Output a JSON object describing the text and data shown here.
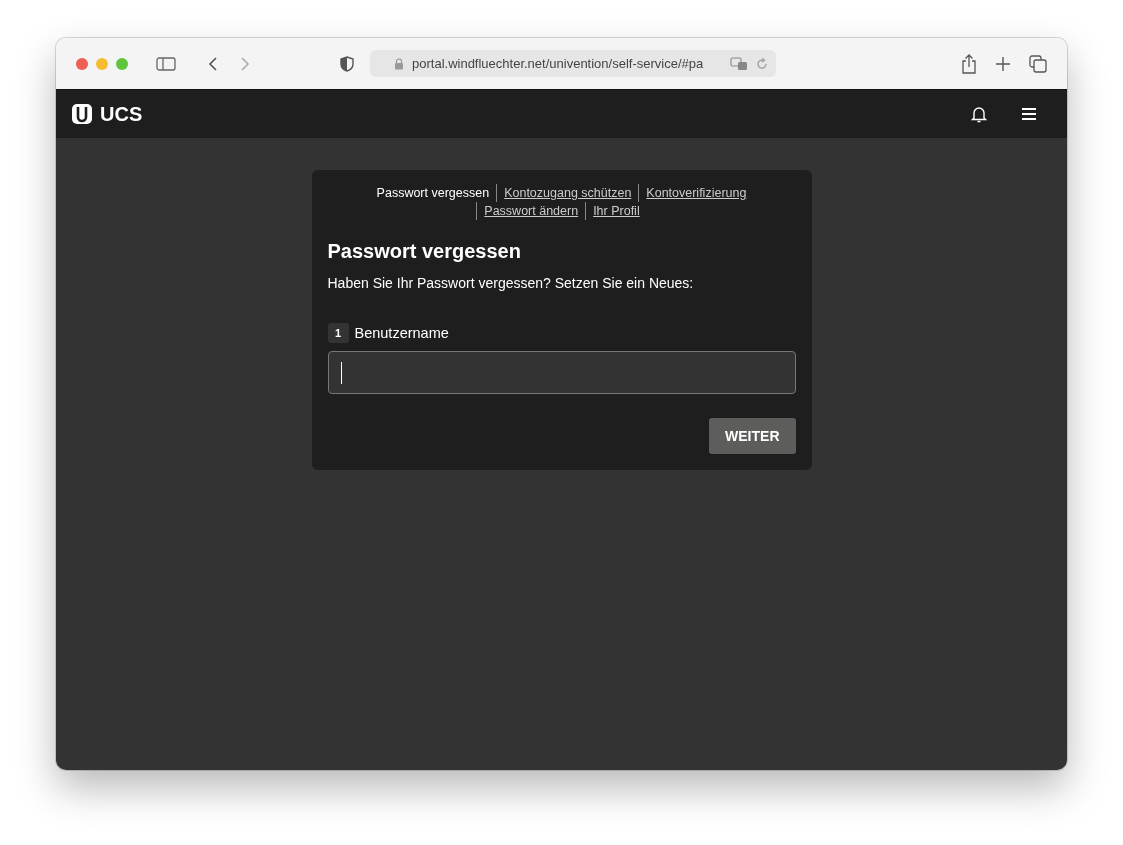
{
  "browser": {
    "url": "portal.windfluechter.net/univention/self-service/#pa"
  },
  "app_header": {
    "logo_text": "UCS"
  },
  "nav": [
    {
      "label": "Passwort vergessen",
      "selected": true
    },
    {
      "label": "Kontozugang schützen",
      "selected": false
    },
    {
      "label": "Kontoverifizierung",
      "selected": false
    },
    {
      "label": "Passwort ändern",
      "selected": false
    },
    {
      "label": "Ihr Profil",
      "selected": false
    }
  ],
  "form": {
    "title": "Passwort vergessen",
    "description": "Haben Sie Ihr Passwort vergessen? Setzen Sie ein Neues:",
    "fields": [
      {
        "step": "1",
        "label": "Benutzername"
      }
    ],
    "button": "WEITER"
  }
}
